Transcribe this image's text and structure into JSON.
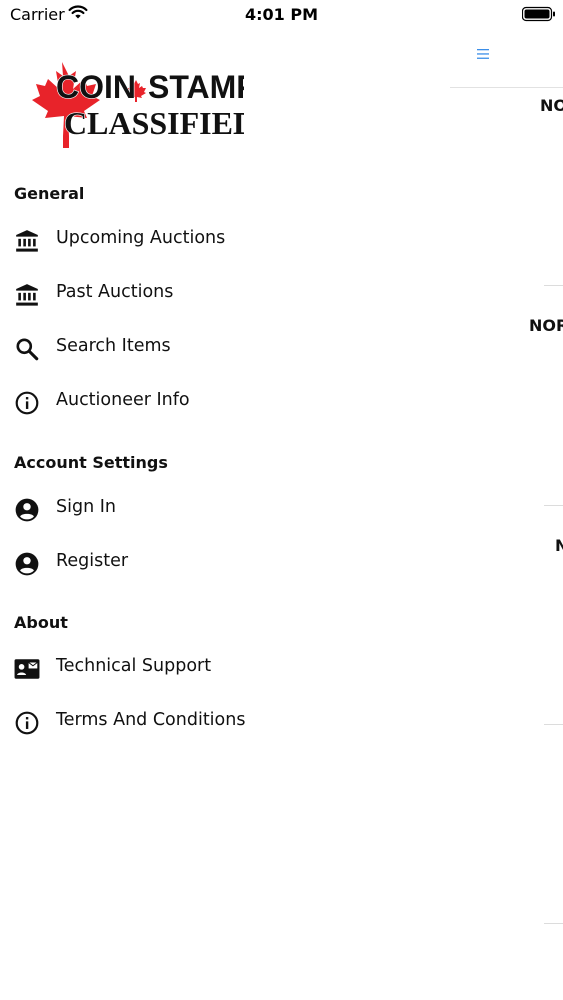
{
  "status_bar": {
    "carrier": "Carrier",
    "time": "4:01 PM"
  },
  "logo": {
    "line1_left": "COIN",
    "line1_right": "STAMP",
    "line2": "CLASSIFIEDS",
    "brand_red": "#e8232a"
  },
  "drawer": {
    "sections": [
      {
        "heading": "General",
        "items": [
          {
            "label": "Upcoming Auctions",
            "icon": "bank-icon"
          },
          {
            "label": "Past Auctions",
            "icon": "bank-icon"
          },
          {
            "label": "Search Items",
            "icon": "search-icon"
          },
          {
            "label": "Auctioneer Info",
            "icon": "info-icon"
          }
        ]
      },
      {
        "heading": "Account Settings",
        "items": [
          {
            "label": "Sign In",
            "icon": "account-circle-icon"
          },
          {
            "label": "Register",
            "icon": "account-circle-icon"
          }
        ]
      },
      {
        "heading": "About",
        "items": [
          {
            "label": "Technical Support",
            "icon": "contact-mail-icon"
          },
          {
            "label": "Terms And Conditions",
            "icon": "info-icon"
          }
        ]
      }
    ]
  },
  "background_page": {
    "menu_icon": "hamburger-icon",
    "accent": "#3b8ee8",
    "labels": [
      "NO",
      "NOR",
      "N"
    ]
  }
}
